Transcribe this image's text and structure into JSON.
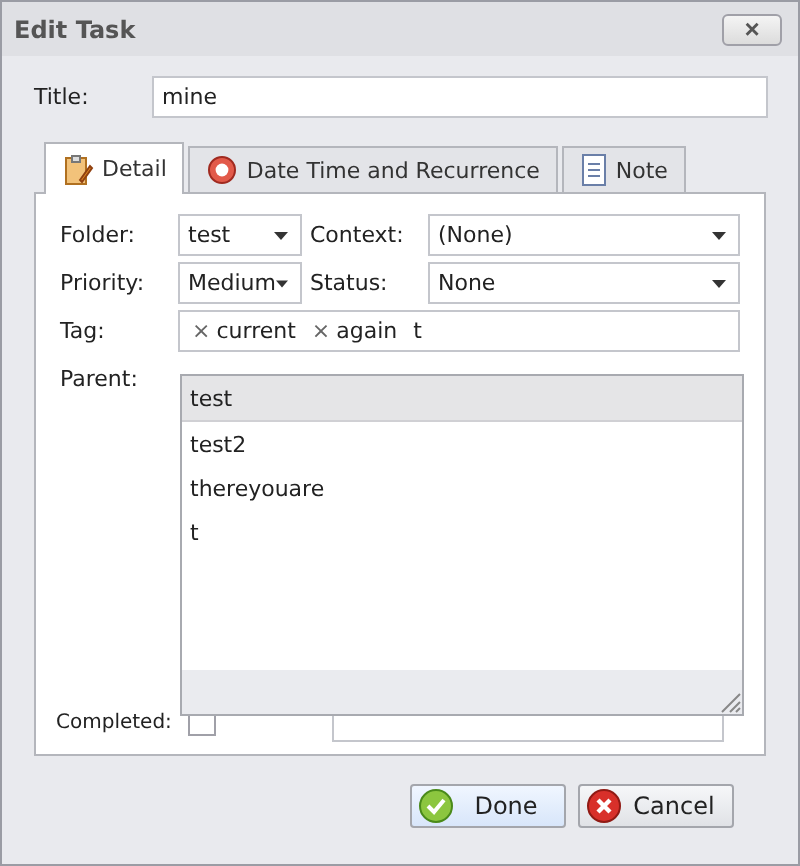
{
  "window": {
    "title": "Edit Task",
    "close": "×"
  },
  "title_field": {
    "label": "Title:",
    "value": "mine"
  },
  "tabs": [
    {
      "label": "Detail",
      "kind": "clipboard",
      "selected": true
    },
    {
      "label": "Date Time and  Recurrence",
      "kind": "ring",
      "selected": false
    },
    {
      "label": "Note",
      "kind": "page",
      "selected": false
    }
  ],
  "folder": {
    "label": "Folder:",
    "value": "test"
  },
  "context": {
    "label": "Context:",
    "value": "(None)"
  },
  "priority": {
    "label": "Priority:",
    "value": "Medium"
  },
  "status": {
    "label": "Status:",
    "value": "None"
  },
  "tag": {
    "label": "Tag:",
    "tokens": [
      "current",
      "again"
    ],
    "remove": "×",
    "value": "t"
  },
  "parent": {
    "label": "Parent:"
  },
  "suggestions": [
    {
      "label": "test",
      "selected": true
    },
    {
      "label": "test2",
      "selected": false
    },
    {
      "label": "thereyouare",
      "selected": false
    },
    {
      "label": "t",
      "selected": false
    }
  ],
  "completed": {
    "label": "Completed:",
    "checked": false
  },
  "buttons": [
    {
      "label": "Done",
      "kind": "ok"
    },
    {
      "label": "Cancel",
      "kind": "cancel"
    }
  ]
}
